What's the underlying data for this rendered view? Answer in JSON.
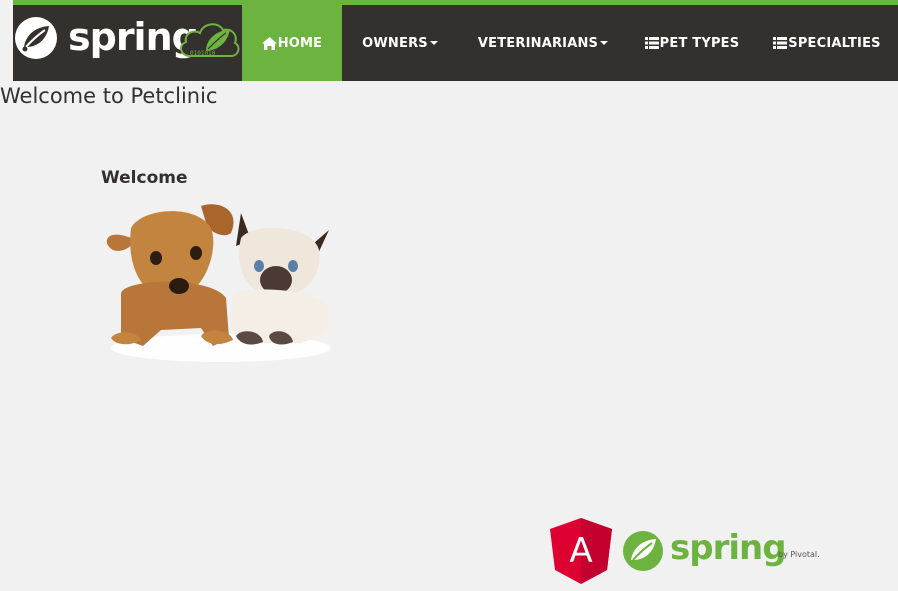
{
  "brand": {
    "word": "spring",
    "cloud_badge": "0101010"
  },
  "nav": {
    "items": [
      {
        "label": "HOME",
        "icon": "home-icon",
        "active": true,
        "dropdown": false
      },
      {
        "label": "OWNERS",
        "icon": "",
        "active": false,
        "dropdown": true
      },
      {
        "label": "VETERINARIANS",
        "icon": "",
        "active": false,
        "dropdown": true
      },
      {
        "label": "PET TYPES",
        "icon": "list-icon",
        "active": false,
        "dropdown": false
      },
      {
        "label": "SPECIALTIES",
        "icon": "list-icon",
        "active": false,
        "dropdown": false
      }
    ]
  },
  "main": {
    "page_title": "Welcome to Petclinic",
    "welcome_heading": "Welcome"
  },
  "footer": {
    "angular_letter": "A",
    "spring_word": "spring",
    "pivotal_text": "by Pivotal."
  },
  "colors": {
    "brand_green": "#6db33f",
    "nav_dark": "#34302d",
    "page_bg": "#f1f1f1",
    "angular_red": "#dd0031"
  }
}
